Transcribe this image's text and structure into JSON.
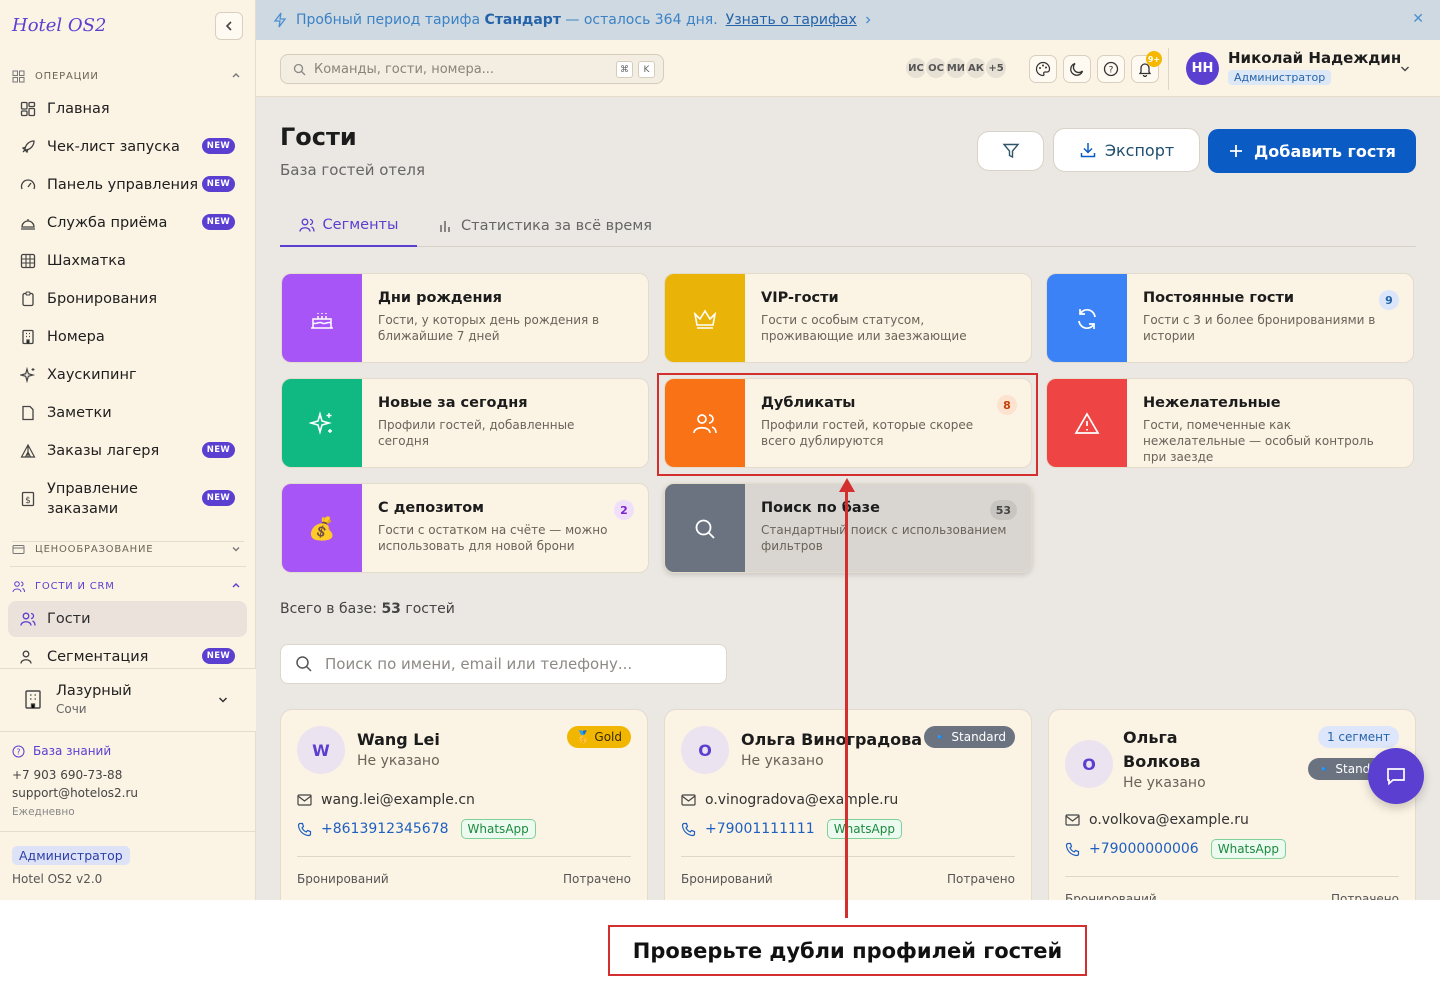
{
  "app": {
    "name": "Hotel OS2"
  },
  "banner": {
    "prefix": "Пробный период тарифа",
    "plan": "Стандарт",
    "suffix": "— осталось 364 дня.",
    "link": "Узнать о тарифах"
  },
  "sidebar": {
    "sections": {
      "operations": "ОПЕРАЦИИ",
      "pricing": "ЦЕНООБРАЗОВАНИЕ",
      "crm": "ГОСТИ И CRM"
    },
    "new_badge": "NEW",
    "items": [
      {
        "label": "Главная",
        "icon": "layout-icon"
      },
      {
        "label": "Чек-лист запуска",
        "icon": "rocket-icon",
        "new": true
      },
      {
        "label": "Панель управления",
        "icon": "gauge-icon",
        "new": true
      },
      {
        "label": "Служба приёма",
        "icon": "bell-service-icon",
        "new": true
      },
      {
        "label": "Шахматка",
        "icon": "grid-icon"
      },
      {
        "label": "Бронирования",
        "icon": "clipboard-icon"
      },
      {
        "label": "Номера",
        "icon": "building-icon"
      },
      {
        "label": "Хаускипинг",
        "icon": "sparkles-icon"
      },
      {
        "label": "Заметки",
        "icon": "note-icon"
      },
      {
        "label": "Заказы лагеря",
        "icon": "tent-icon",
        "new": true
      },
      {
        "label": "Управление заказами",
        "icon": "receipt-icon",
        "new": true
      },
      {
        "label": "Гости",
        "icon": "users-icon",
        "active": true
      },
      {
        "label": "Сегментация",
        "icon": "target-icon",
        "new": true
      }
    ],
    "hotel": {
      "name": "Лазурный",
      "city": "Сочи"
    },
    "kb": "База знаний",
    "phone": "+7 903 690-73-88",
    "email": "support@hotelos2.ru",
    "hours": "Ежедневно",
    "role": "Администратор",
    "version": "Hotel OS2 v2.0"
  },
  "topbar": {
    "search_placeholder": "Команды, гости, номера...",
    "kbd1": "⌘",
    "kbd2": "K",
    "avatars": [
      "ИС",
      "ОС",
      "МИ",
      "АК",
      "+5"
    ],
    "notif_count": "9+",
    "user": {
      "initials": "НН",
      "name": "Николай Надеждин",
      "role": "Администратор"
    }
  },
  "page": {
    "title": "Гости",
    "subtitle": "База гостей отеля",
    "export": "Экспорт",
    "add": "Добавить гостя",
    "tabs": [
      "Сегменты",
      "Статистика за всё время"
    ],
    "total_label": "Всего в базе:",
    "total_count": "53",
    "total_unit": "гостей",
    "search_placeholder": "Поиск по имени, email или телефону..."
  },
  "segments": [
    {
      "title": "Дни рождения",
      "desc": "Гости, у которых день рождения в ближайшие 7 дней",
      "color": "#a855f7",
      "icon": "cake-icon"
    },
    {
      "title": "VIP-гости",
      "desc": "Гости с особым статусом, проживающие или заезжающие",
      "color": "#eab308",
      "icon": "crown-icon"
    },
    {
      "title": "Постоянные гости",
      "desc": "Гости с 3 и более бронированиями в истории",
      "color": "#3b82f6",
      "icon": "refresh-icon",
      "count": "9"
    },
    {
      "title": "Новые за сегодня",
      "desc": "Профили гостей, добавленные сегодня",
      "color": "#10b981",
      "icon": "sparkles-icon"
    },
    {
      "title": "Дубликаты",
      "desc": "Профили гостей, которые скорее всего дублируются",
      "color": "#f97316",
      "icon": "users-icon",
      "count": "8"
    },
    {
      "title": "Нежелательные",
      "desc": "Гости, помеченные как нежелательные — особый контроль при заезде",
      "color": "#ef4444",
      "icon": "warning-icon"
    },
    {
      "title": "С депозитом",
      "desc": "Гости с остатком на счёте — можно использовать для новой брони",
      "color": "#a855f7",
      "icon": "moneybag-icon",
      "count": "2"
    },
    {
      "title": "Поиск по базе",
      "desc": "Стандартный поиск с использованием фильтров",
      "color": "#6b7280",
      "icon": "search-icon",
      "count": "53"
    }
  ],
  "guests": [
    {
      "initial": "W",
      "name": "Wang Lei",
      "sub": "Не указано",
      "tier": "🥇 Gold",
      "email": "wang.lei@example.cn",
      "phone": "+8613912345678",
      "wa": "WhatsApp",
      "bookings_label": "Бронирований",
      "spent_label": "Потрачено"
    },
    {
      "initial": "О",
      "name": "Ольга Виноградова",
      "sub": "Не указано",
      "tier": "🔹 Standard",
      "email": "o.vinogradova@example.ru",
      "phone": "+79001111111",
      "wa": "WhatsApp",
      "bookings_label": "Бронирований",
      "spent_label": "Потрачено"
    },
    {
      "initial": "О",
      "name_line1": "Ольга",
      "name_line2": "Волкова",
      "sub": "Не указано",
      "segment": "1 сегмент",
      "tier": "🔹 Standard",
      "email": "o.volkova@example.ru",
      "phone": "+79000000006",
      "wa": "WhatsApp",
      "bookings_label": "Бронирований",
      "spent_label": "Потрачено"
    }
  ],
  "annotation": {
    "label": "Проверьте дубли профилей гостей"
  }
}
